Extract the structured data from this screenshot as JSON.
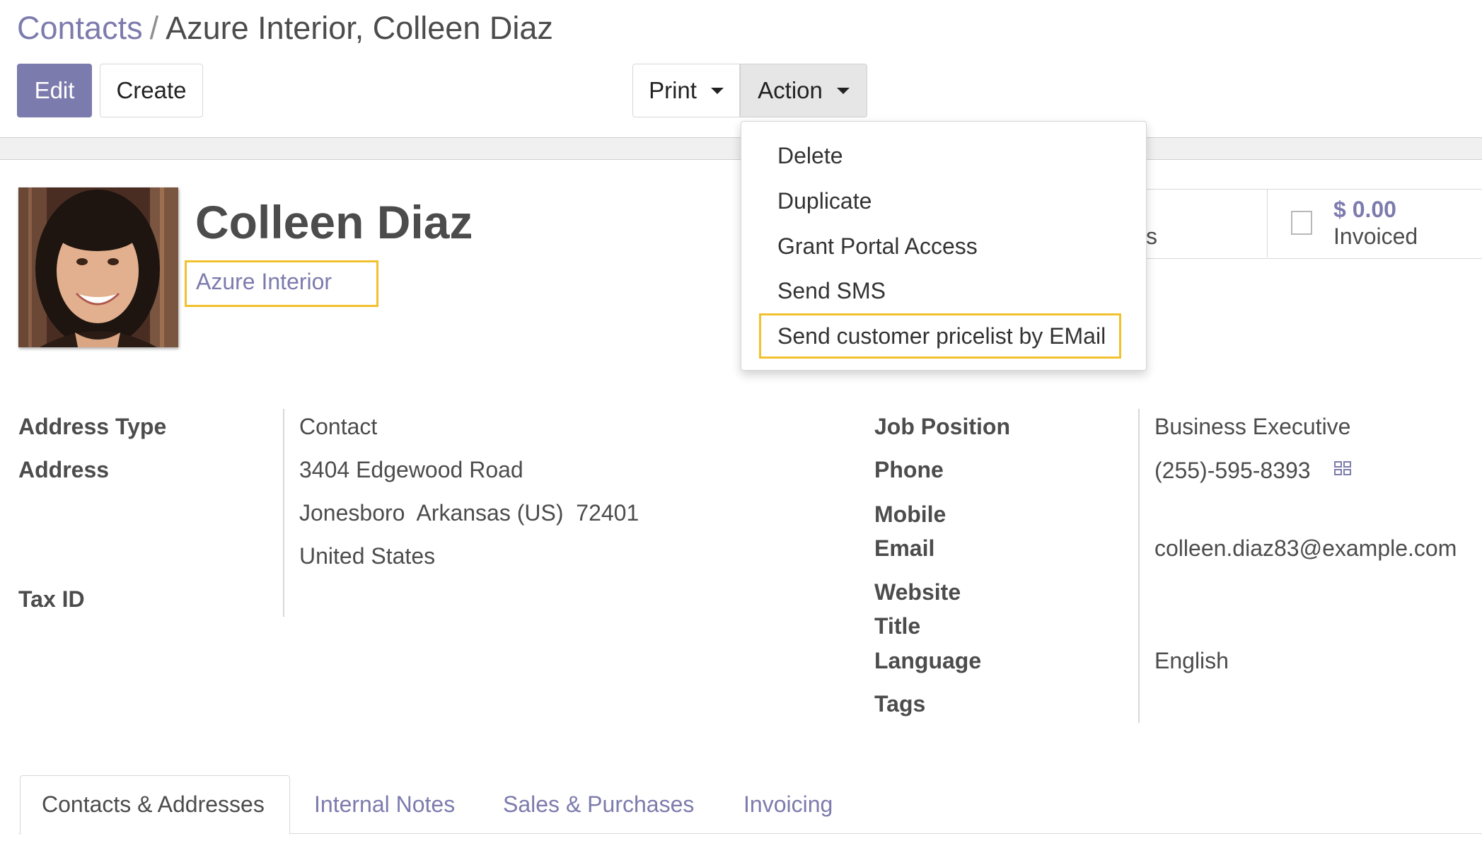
{
  "breadcrumb": {
    "parent": "Contacts",
    "separator": "/",
    "current": "Azure Interior, Colleen Diaz"
  },
  "toolbar": {
    "edit_label": "Edit",
    "create_label": "Create",
    "print_label": "Print",
    "action_label": "Action"
  },
  "action_menu": {
    "items": [
      "Delete",
      "Duplicate",
      "Grant Portal Access",
      "Send SMS",
      "Send customer pricelist by EMail"
    ]
  },
  "stat_buttons": {
    "partial_label": "s",
    "invoiced_value": "$ 0.00",
    "invoiced_label": "Invoiced"
  },
  "contact": {
    "name": "Colleen Diaz",
    "company": "Azure Interior"
  },
  "left_fields": {
    "address_type_label": "Address Type",
    "address_type_value": "Contact",
    "address_label": "Address",
    "street": "3404 Edgewood Road",
    "city": "Jonesboro",
    "state": "Arkansas (US)",
    "zip": "72401",
    "country": "United States",
    "tax_id_label": "Tax ID"
  },
  "right_fields": {
    "job_position_label": "Job Position",
    "job_position_value": "Business Executive",
    "phone_label": "Phone",
    "phone_value": "(255)-595-8393",
    "mobile_label": "Mobile",
    "email_label": "Email",
    "email_value": "colleen.diaz83@example.com",
    "website_label": "Website",
    "title_label": "Title",
    "language_label": "Language",
    "language_value": "English",
    "tags_label": "Tags"
  },
  "tabs": [
    {
      "label": "Contacts & Addresses",
      "active": true
    },
    {
      "label": "Internal Notes",
      "active": false
    },
    {
      "label": "Sales & Purchases",
      "active": false
    },
    {
      "label": "Invoicing",
      "active": false
    }
  ],
  "colors": {
    "primary": "#7c7bad",
    "highlight": "#f2c12e",
    "text": "#4c4c4c"
  }
}
